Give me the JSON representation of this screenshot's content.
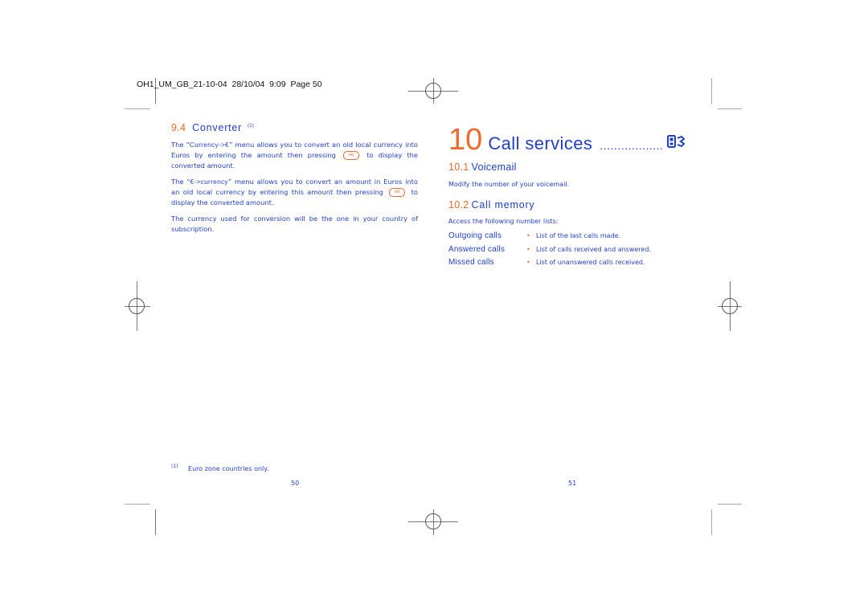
{
  "header": {
    "slug": "OH1_UM_GB_21-10-04  28/10/04  9:09  Page 50"
  },
  "left_page": {
    "section_number": "9.4",
    "section_title": "Converter",
    "section_footnote_ref": "(1)",
    "paragraphs": [
      {
        "before": "The “",
        "menu": "Currency->€",
        "middle": "” menu allows you to convert an old local currency into Euros by entering the amount then pressing",
        "key": "ok",
        "after": "to display the converted amount."
      },
      {
        "before": "The “",
        "menu": "€->currency",
        "middle": "” menu allows you to convert an amount in Euros into an old local currency by entering this amount then pressing",
        "key": "ok",
        "after": "to display the converted amount."
      },
      {
        "text": "The currency used for conversion will be the one in your country of subscription."
      }
    ],
    "footnote": {
      "ref": "(1)",
      "text": "Euro zone countries only."
    },
    "page_number": "50"
  },
  "right_page": {
    "chapter_number": "10",
    "chapter_title": "Call services",
    "chapter_dots": "..................",
    "chapter_icon": "phone-keypad-icon",
    "sections": [
      {
        "number": "10.1",
        "title": "Voicemail",
        "body": "Modify the number of your voicemail."
      },
      {
        "number": "10.2",
        "title": "Call memory",
        "intro": "Access the following number lists:",
        "items": [
          {
            "label": "Outgoing calls",
            "bullet": "•",
            "description": "List of the last calls made."
          },
          {
            "label": "Answered calls",
            "bullet": "•",
            "description": "List of calls received and answered."
          },
          {
            "label": "Missed calls",
            "bullet": "•",
            "description": "List of unanswered calls received."
          }
        ]
      }
    ],
    "page_number": "51"
  },
  "colors": {
    "accent_orange": "#f06a2a",
    "text_blue": "#1f3fc9",
    "crop_mark": "#777777"
  }
}
